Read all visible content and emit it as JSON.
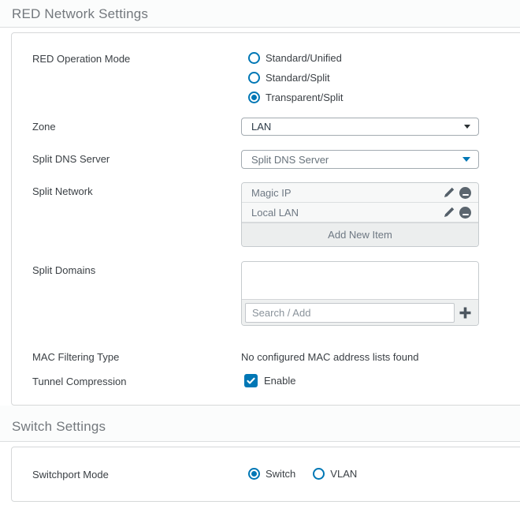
{
  "accent_color": "#0077b5",
  "red": {
    "title": "RED Network Settings",
    "operation_mode": {
      "label": "RED Operation Mode",
      "options": [
        {
          "label": "Standard/Unified",
          "selected": false
        },
        {
          "label": "Standard/Split",
          "selected": false
        },
        {
          "label": "Transparent/Split",
          "selected": true
        }
      ]
    },
    "zone": {
      "label": "Zone",
      "value": "LAN"
    },
    "split_dns": {
      "label": "Split DNS Server",
      "value": "Split DNS Server"
    },
    "split_network": {
      "label": "Split Network",
      "items": [
        {
          "name": "Magic IP"
        },
        {
          "name": "Local LAN"
        }
      ],
      "add_button": "Add New Item"
    },
    "split_domains": {
      "label": "Split Domains",
      "search_placeholder": "Search / Add"
    },
    "mac_filtering": {
      "label": "MAC Filtering Type",
      "value": "No configured MAC address lists found"
    },
    "tunnel_compression": {
      "label": "Tunnel Compression",
      "option": "Enable",
      "enabled": true
    }
  },
  "switch": {
    "title": "Switch Settings",
    "switchport_mode": {
      "label": "Switchport Mode",
      "options": [
        {
          "label": "Switch",
          "selected": true
        },
        {
          "label": "VLAN",
          "selected": false
        }
      ]
    }
  }
}
